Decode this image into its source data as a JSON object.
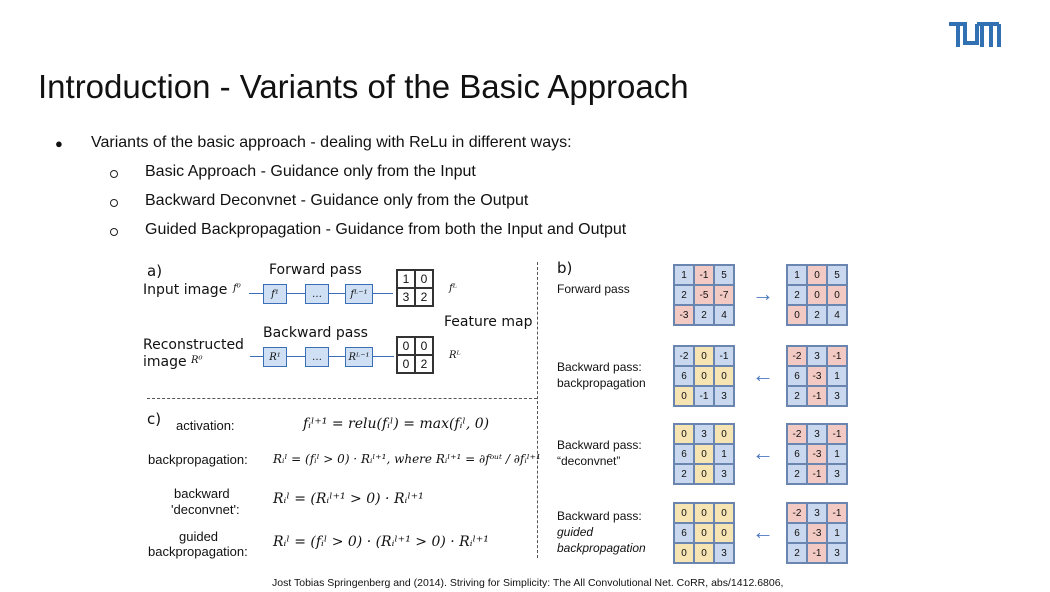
{
  "slide": {
    "title": "Introduction - Variants of the Basic Approach",
    "bullets": {
      "main": "Variants of the basic approach - dealing with ReLu in different ways:",
      "sub": [
        "Basic Approach - Guidance only from the Input",
        "Backward Deconvnet - Guidance only from the Output",
        "Guided Backpropagation - Guidance from both the Input and Output"
      ]
    },
    "citation": "Jost Tobias Springenberg and (2014). Striving for Simplicity: The All Convolutional Net. CoRR, abs/1412.6806,"
  },
  "figure_a": {
    "label": "a)",
    "forward_pass": "Forward pass",
    "input_image": "Input image",
    "input_sym": "f⁰",
    "blocks_fwd": [
      "f¹",
      "…",
      "fᴸ⁻¹"
    ],
    "out_sym": "fᴸ",
    "feature_map": "Feature map",
    "fmap_values": [
      "1",
      "0",
      "3",
      "2"
    ],
    "backward_pass": "Backward pass",
    "reconstructed_image": "Reconstructed",
    "image_label": "image",
    "recon_sym": "R⁰",
    "blocks_bwd": [
      "R¹",
      "…",
      "Rᴸ⁻¹"
    ],
    "rmap_values": [
      "0",
      "0",
      "0",
      "2"
    ],
    "r_sym": "Rᴸ"
  },
  "figure_b": {
    "label": "b)",
    "rows": [
      {
        "label1": "Forward pass",
        "label2": "",
        "label3": "",
        "left": [
          "1",
          "-1",
          "5",
          "2",
          "-5",
          "-7",
          "-3",
          "2",
          "4"
        ],
        "right": [
          "1",
          "0",
          "5",
          "2",
          "0",
          "0",
          "0",
          "2",
          "4"
        ],
        "dir": "→"
      },
      {
        "label1": "Backward pass:",
        "label2": "backpropagation",
        "label3": "",
        "left": [
          "-2",
          "0",
          "-1",
          "6",
          "0",
          "0",
          "0",
          "-1",
          "3"
        ],
        "right": [
          "-2",
          "3",
          "-1",
          "6",
          "-3",
          "1",
          "2",
          "-1",
          "3"
        ],
        "dir": "←"
      },
      {
        "label1": "Backward pass:",
        "label2": "“deconvnet”",
        "label3": "",
        "left": [
          "0",
          "3",
          "0",
          "6",
          "0",
          "1",
          "2",
          "0",
          "3"
        ],
        "right": [
          "-2",
          "3",
          "-1",
          "6",
          "-3",
          "1",
          "2",
          "-1",
          "3"
        ],
        "dir": "←"
      },
      {
        "label1": "Backward pass:",
        "label2": "guided",
        "label3": "backpropagation",
        "left": [
          "0",
          "0",
          "0",
          "6",
          "0",
          "0",
          "0",
          "0",
          "3"
        ],
        "right": [
          "-2",
          "3",
          "-1",
          "6",
          "-3",
          "1",
          "2",
          "-1",
          "3"
        ],
        "dir": "←"
      }
    ]
  },
  "figure_c": {
    "label": "c)",
    "rows": [
      {
        "name": "activation:",
        "formula": "fᵢˡ⁺¹ = relu(fᵢˡ) = max(fᵢˡ, 0)"
      },
      {
        "name": "backpropagation:",
        "formula": "Rᵢˡ = (fᵢˡ > 0) · Rᵢˡ⁺¹, where Rᵢˡ⁺¹ = ∂fᵒᵘᵗ / ∂fᵢˡ⁺¹"
      },
      {
        "name": "backward",
        "name2": "'deconvnet':",
        "formula": "Rᵢˡ = (Rᵢˡ⁺¹ > 0) · Rᵢˡ⁺¹"
      },
      {
        "name": "guided",
        "name2": "backpropagation:",
        "formula": "Rᵢˡ = (fᵢˡ > 0) · (Rᵢˡ⁺¹ > 0) · Rᵢˡ⁺¹"
      }
    ]
  },
  "colors": {
    "brand": "#3070b3",
    "cell_blue": "#c9d8ee",
    "cell_red": "#f2c9c3",
    "cell_yellow": "#f7e4b3",
    "formula_red": "#d9342b",
    "formula_yellow": "#d8c23a"
  },
  "logo": {
    "text": "TUM"
  }
}
